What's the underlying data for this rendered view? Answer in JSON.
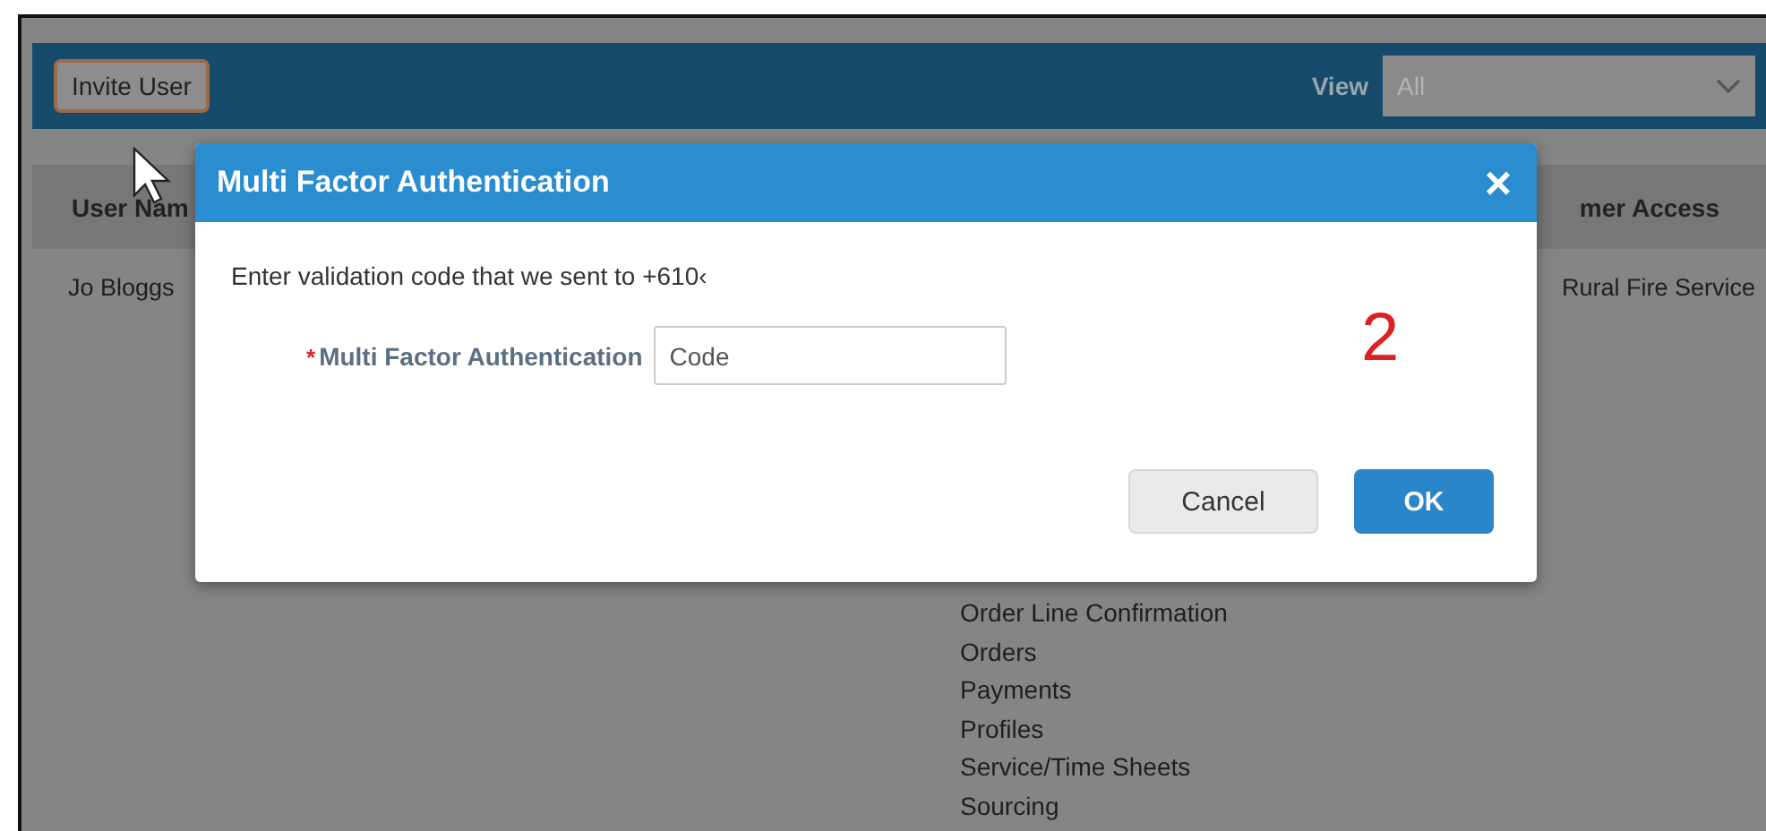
{
  "toolbar": {
    "invite_button": "Invite User",
    "view_label": "View",
    "view_value": "All"
  },
  "table": {
    "columns": [
      "User Nam",
      "mer Access"
    ],
    "rows": [
      {
        "name": "Jo Bloggs",
        "access": "Rural Fire Service"
      }
    ],
    "permissions": [
      "Order Line Confirmation",
      "Orders",
      "Payments",
      "Profiles",
      "Service/Time Sheets",
      "Sourcing"
    ]
  },
  "dialog": {
    "title": "Multi Factor Authentication",
    "message": "Enter validation code that we sent to +610‹",
    "field_label": "Multi Factor Authentication",
    "required": true,
    "required_mark": "*",
    "field_placeholder": "Code",
    "close": "×",
    "buttons": [
      {
        "label": "Cancel",
        "kind": "secondary"
      },
      {
        "label": "OK",
        "kind": "primary"
      }
    ]
  },
  "annotation": "2"
}
